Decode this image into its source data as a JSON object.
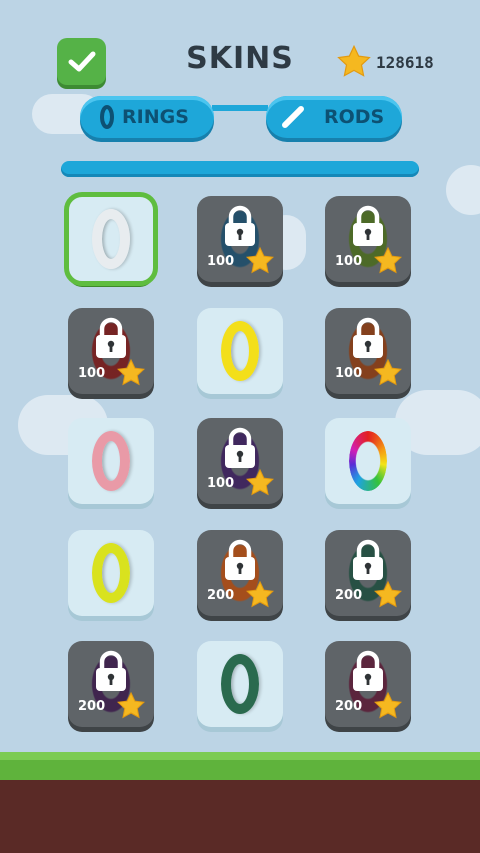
{
  "header": {
    "title": "SKINS",
    "coins": "128618"
  },
  "tabs": [
    {
      "label": "RINGS"
    },
    {
      "label": "RODS"
    }
  ],
  "colors": {
    "accent": "#1ea7d9",
    "selected": "#5fbd3f",
    "locked": "#5f6468",
    "star": "#f5b820"
  },
  "skins": [
    {
      "state": "selected",
      "color": "#e8ecef"
    },
    {
      "state": "locked",
      "price": "100",
      "color": "#1b4d6b"
    },
    {
      "state": "locked",
      "price": "100",
      "color": "#4a6b1c"
    },
    {
      "state": "locked",
      "price": "100",
      "color": "#7a1818"
    },
    {
      "state": "unlocked",
      "color": "#f3df1a"
    },
    {
      "state": "locked",
      "price": "100",
      "color": "#8a3a10"
    },
    {
      "state": "unlocked",
      "color": "#e99aa7"
    },
    {
      "state": "locked",
      "price": "100",
      "color": "#3b1d5c"
    },
    {
      "state": "unlocked",
      "color": "rainbow"
    },
    {
      "state": "unlocked",
      "color": "#d9e21e"
    },
    {
      "state": "locked",
      "price": "200",
      "color": "#b04a0e"
    },
    {
      "state": "locked",
      "price": "200",
      "color": "#1d4d3d"
    },
    {
      "state": "locked",
      "price": "200",
      "color": "#3a1a4a"
    },
    {
      "state": "unlocked",
      "color": "#2a6a4e"
    },
    {
      "state": "locked",
      "price": "200",
      "color": "#5a1a35"
    }
  ]
}
